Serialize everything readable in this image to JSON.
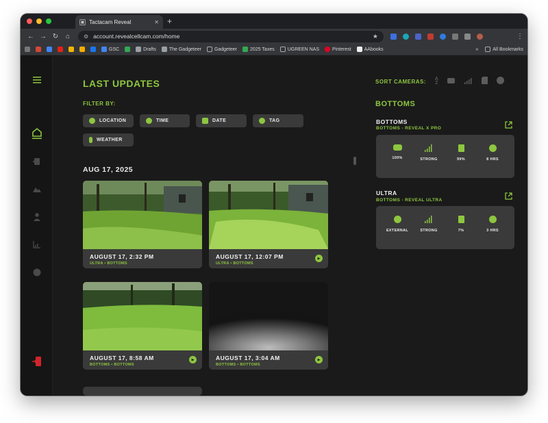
{
  "browser": {
    "tab_title": "Tactacam Reveal",
    "url": "account.revealcellcam.com/home",
    "bookmarks": [
      "GSC",
      "Drafts",
      "The Gadgeteer",
      "Gadgeteer",
      "2025 Taxes",
      "UGREEN NAS",
      "Pinterest",
      "AAbooks"
    ],
    "all_bookmarks": "All Bookmarks",
    "colors": {
      "close": "#ff5f57",
      "minimize": "#febc2e",
      "zoom": "#28c840"
    }
  },
  "app": {
    "accent": "#8dc63f",
    "title": "LAST UPDATES",
    "filter_label": "FILTER BY:",
    "filters": [
      "LOCATION",
      "TIME",
      "DATE",
      "TAG",
      "WEATHER"
    ],
    "date_heading": "AUG 17, 2025",
    "cards": [
      {
        "title": "AUGUST 17, 2:32 PM",
        "subtitle": "ULTRA • BOTTOMS"
      },
      {
        "title": "AUGUST 17, 12:07 PM",
        "subtitle": "ULTRA • BOTTOMS"
      },
      {
        "title": "AUGUST 17, 8:58 AM",
        "subtitle": "BOTTOMS • BOTTOMS"
      },
      {
        "title": "AUGUST 17, 3:04 AM",
        "subtitle": "BOTTOMS • BOTTOMS"
      }
    ],
    "sort_label": "SORT CAMERAS:",
    "group_title": "BOTTOMS",
    "cameras": [
      {
        "name": "BOTTOMS",
        "subtitle": "BOTTOMS - REVEAL X PRO",
        "stats": [
          "100%",
          "STRONG",
          "99%",
          "8 HRS"
        ]
      },
      {
        "name": "ULTRA",
        "subtitle": "BOTTOMS - REVEAL ULTRA",
        "stats": [
          "EXTERNAL",
          "STRONG",
          "7%",
          "3 HRS"
        ]
      }
    ]
  }
}
